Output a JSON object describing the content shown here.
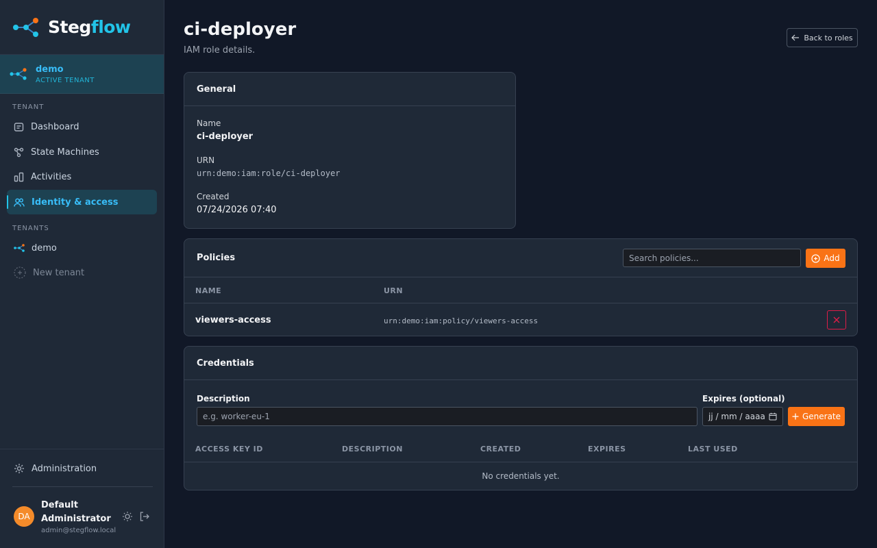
{
  "brand": {
    "name_part1": "Steg",
    "name_part2": "flow",
    "accent": "#22c4e8"
  },
  "tenant": {
    "name": "demo",
    "status": "ACTIVE TENANT"
  },
  "sidebar": {
    "section_tenant": "TENANT",
    "items": [
      {
        "label": "Dashboard",
        "icon": "dashboard-icon"
      },
      {
        "label": "State Machines",
        "icon": "state-machine-icon"
      },
      {
        "label": "Activities",
        "icon": "activities-icon"
      },
      {
        "label": "Identity & access",
        "icon": "users-icon",
        "active": true
      }
    ],
    "section_tenants": "TENANTS",
    "tenants": [
      {
        "label": "demo"
      }
    ],
    "new_tenant": "New tenant",
    "administration": "Administration"
  },
  "user": {
    "initials": "DA",
    "name": "Default Administrator",
    "email": "admin@stegflow.local"
  },
  "page": {
    "title": "ci-deployer",
    "subtitle": "IAM role details.",
    "back_label": "Back to roles"
  },
  "general": {
    "heading": "General",
    "name_label": "Name",
    "name_value": "ci-deployer",
    "urn_label": "URN",
    "urn_value": "urn:demo:iam:role/ci-deployer",
    "created_label": "Created",
    "created_value": "07/24/2026 07:40"
  },
  "policies": {
    "heading": "Policies",
    "search_placeholder": "Search policies...",
    "add_label": "Add",
    "columns": [
      "NAME",
      "URN"
    ],
    "rows": [
      {
        "name": "viewers-access",
        "urn": "urn:demo:iam:policy/viewers-access"
      }
    ]
  },
  "credentials": {
    "heading": "Credentials",
    "description_label": "Description",
    "description_placeholder": "e.g. worker-eu-1",
    "expires_label": "Expires (optional)",
    "expires_placeholder": "jj / mm / aaaa",
    "generate_label": "Generate",
    "columns": [
      "ACCESS KEY ID",
      "DESCRIPTION",
      "CREATED",
      "EXPIRES",
      "LAST USED"
    ],
    "empty_text": "No credentials yet."
  },
  "colors": {
    "action": "#f97316",
    "danger": "#e11d48",
    "accent": "#22c4e8"
  }
}
